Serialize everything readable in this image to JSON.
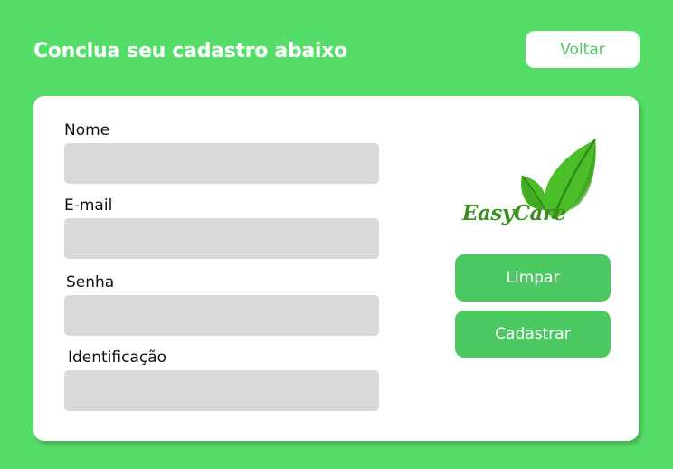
{
  "header": {
    "title": "Conclua seu cadastro abaixo",
    "back_label": "Voltar"
  },
  "form": {
    "fields": [
      {
        "label": "Nome",
        "value": "",
        "placeholder": ""
      },
      {
        "label": "E-mail",
        "value": "",
        "placeholder": ""
      },
      {
        "label": "Senha",
        "value": "",
        "placeholder": ""
      },
      {
        "label": "Identificação",
        "value": "",
        "placeholder": ""
      }
    ]
  },
  "brand": {
    "name": "EasyCare",
    "icon": "leaf-logo-icon",
    "color": "#3a8f1e"
  },
  "actions": {
    "clear_label": "Limpar",
    "submit_label": "Cadastrar"
  },
  "colors": {
    "background": "#55dd69",
    "button": "#4cc962",
    "input": "#d9d9d9"
  }
}
